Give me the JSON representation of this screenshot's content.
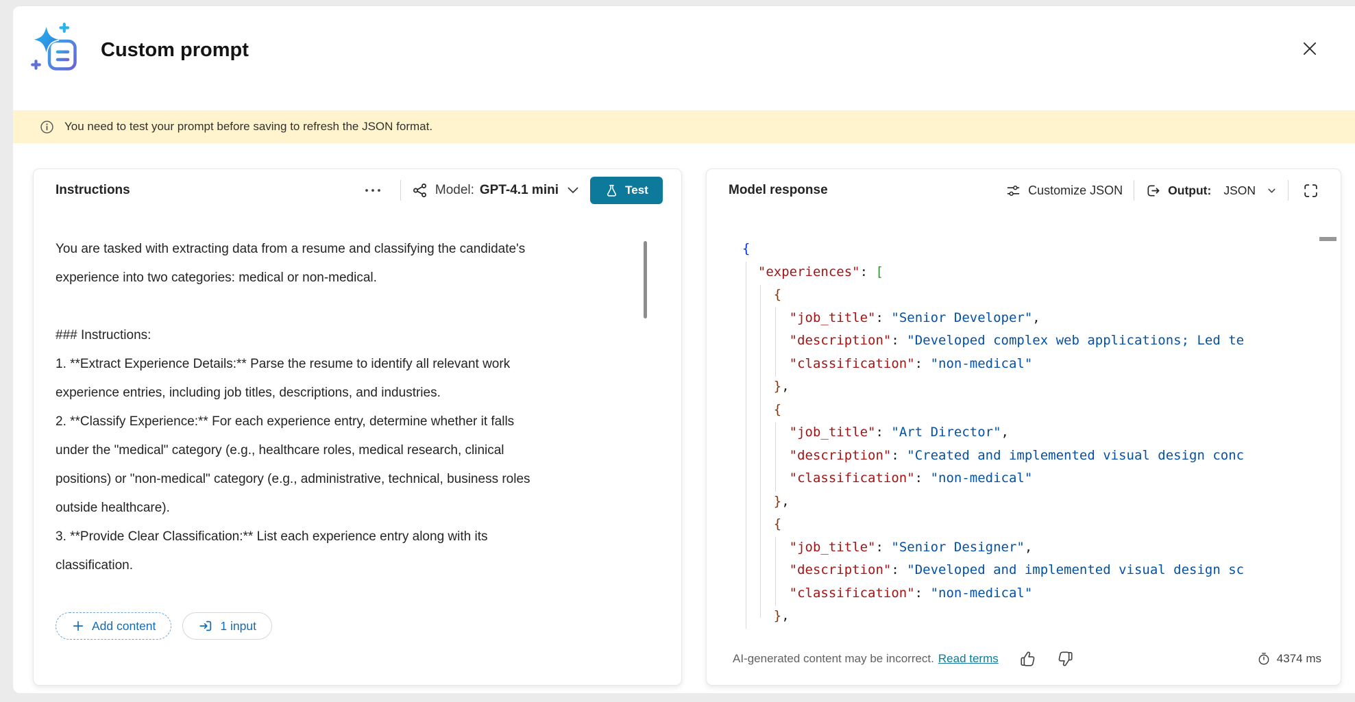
{
  "header": {
    "title": "Custom prompt"
  },
  "banner": {
    "text": "You need to test your prompt before saving to refresh the JSON format."
  },
  "instructions_panel": {
    "title": "Instructions",
    "model_label": "Model:",
    "model_value": "GPT-4.1 mini",
    "test_label": "Test",
    "paragraphs": [
      "You are tasked with extracting data from a resume and classifying the candidate's experience into two categories: medical or non-medical.",
      "",
      "### Instructions:",
      "1. **Extract Experience Details:** Parse the resume to identify all relevant work experience entries, including job titles, descriptions, and industries.",
      "2. **Classify Experience:** For each experience entry, determine whether it falls under the \"medical\" category (e.g., healthcare roles, medical research, clinical positions) or \"non-medical\" category (e.g., administrative, technical, business roles outside healthcare).",
      "3. **Provide Clear Classification:** List each experience entry along with its classification."
    ],
    "add_content_label": "Add content",
    "input_chip_label": "1 input"
  },
  "response_panel": {
    "title": "Model response",
    "customize_label": "Customize JSON",
    "output_label": "Output:",
    "output_value": "JSON",
    "disclaimer": "AI-generated content may be incorrect.",
    "terms_label": "Read terms",
    "latency": "4374 ms",
    "code_lines": [
      [
        {
          "t": "{",
          "c": "b1"
        }
      ],
      [
        {
          "t": "  ",
          "c": "p"
        },
        {
          "t": "\"experiences\"",
          "c": "k"
        },
        {
          "t": ": ",
          "c": "p"
        },
        {
          "t": "[",
          "c": "b2"
        }
      ],
      [
        {
          "t": "    ",
          "c": "p"
        },
        {
          "t": "{",
          "c": "b3"
        }
      ],
      [
        {
          "t": "      ",
          "c": "p"
        },
        {
          "t": "\"job_title\"",
          "c": "k"
        },
        {
          "t": ": ",
          "c": "p"
        },
        {
          "t": "\"Senior Developer\"",
          "c": "v"
        },
        {
          "t": ",",
          "c": "p"
        }
      ],
      [
        {
          "t": "      ",
          "c": "p"
        },
        {
          "t": "\"description\"",
          "c": "k"
        },
        {
          "t": ": ",
          "c": "p"
        },
        {
          "t": "\"Developed complex web applications; Led te",
          "c": "v"
        }
      ],
      [
        {
          "t": "      ",
          "c": "p"
        },
        {
          "t": "\"classification\"",
          "c": "k"
        },
        {
          "t": ": ",
          "c": "p"
        },
        {
          "t": "\"non-medical\"",
          "c": "v"
        }
      ],
      [
        {
          "t": "    ",
          "c": "p"
        },
        {
          "t": "}",
          "c": "b3"
        },
        {
          "t": ",",
          "c": "p"
        }
      ],
      [
        {
          "t": "    ",
          "c": "p"
        },
        {
          "t": "{",
          "c": "b3"
        }
      ],
      [
        {
          "t": "      ",
          "c": "p"
        },
        {
          "t": "\"job_title\"",
          "c": "k"
        },
        {
          "t": ": ",
          "c": "p"
        },
        {
          "t": "\"Art Director\"",
          "c": "v"
        },
        {
          "t": ",",
          "c": "p"
        }
      ],
      [
        {
          "t": "      ",
          "c": "p"
        },
        {
          "t": "\"description\"",
          "c": "k"
        },
        {
          "t": ": ",
          "c": "p"
        },
        {
          "t": "\"Created and implemented visual design conc",
          "c": "v"
        }
      ],
      [
        {
          "t": "      ",
          "c": "p"
        },
        {
          "t": "\"classification\"",
          "c": "k"
        },
        {
          "t": ": ",
          "c": "p"
        },
        {
          "t": "\"non-medical\"",
          "c": "v"
        }
      ],
      [
        {
          "t": "    ",
          "c": "p"
        },
        {
          "t": "}",
          "c": "b3"
        },
        {
          "t": ",",
          "c": "p"
        }
      ],
      [
        {
          "t": "    ",
          "c": "p"
        },
        {
          "t": "{",
          "c": "b3"
        }
      ],
      [
        {
          "t": "      ",
          "c": "p"
        },
        {
          "t": "\"job_title\"",
          "c": "k"
        },
        {
          "t": ": ",
          "c": "p"
        },
        {
          "t": "\"Senior Designer\"",
          "c": "v"
        },
        {
          "t": ",",
          "c": "p"
        }
      ],
      [
        {
          "t": "      ",
          "c": "p"
        },
        {
          "t": "\"description\"",
          "c": "k"
        },
        {
          "t": ": ",
          "c": "p"
        },
        {
          "t": "\"Developed and implemented visual design sc",
          "c": "v"
        }
      ],
      [
        {
          "t": "      ",
          "c": "p"
        },
        {
          "t": "\"classification\"",
          "c": "k"
        },
        {
          "t": ": ",
          "c": "p"
        },
        {
          "t": "\"non-medical\"",
          "c": "v"
        }
      ],
      [
        {
          "t": "    ",
          "c": "p"
        },
        {
          "t": "}",
          "c": "b3"
        },
        {
          "t": ",",
          "c": "p"
        }
      ]
    ]
  },
  "icons": [
    "sparkle-document-icon",
    "close-icon",
    "info-icon",
    "more-options-icon",
    "model-icon",
    "chevron-down-icon",
    "flask-icon",
    "plus-icon",
    "arrow-enter-icon",
    "sliders-icon",
    "output-icon",
    "fullscreen-icon",
    "thumb-up-icon",
    "thumb-down-icon",
    "timer-icon"
  ],
  "colors": {
    "accent_teal": "#0e7a9b",
    "link_blue": "#0f6cbd",
    "banner_bg": "#fff4ce",
    "code_key": "#a31515",
    "code_string": "#0451a5",
    "brace_level1": "#0431fa",
    "brace_level2": "#319331",
    "brace_level3": "#7b3814"
  }
}
